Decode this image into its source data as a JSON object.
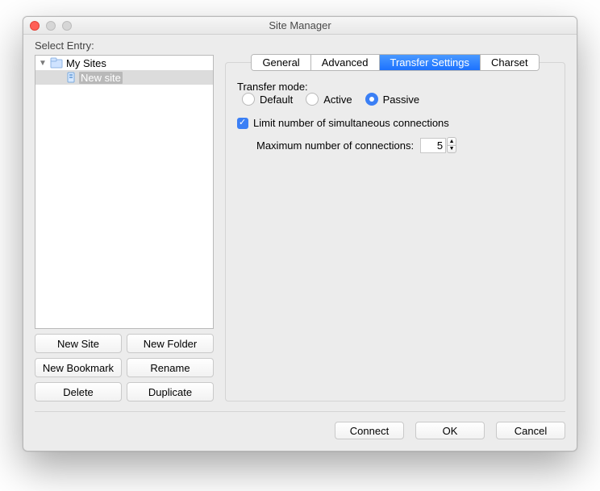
{
  "window": {
    "title": "Site Manager"
  },
  "left": {
    "header": "Select Entry:",
    "tree": {
      "root": {
        "label": "My Sites"
      },
      "child": {
        "label": "New site"
      }
    },
    "buttons": {
      "new_site": "New Site",
      "new_folder": "New Folder",
      "new_bookmark": "New Bookmark",
      "rename": "Rename",
      "delete": "Delete",
      "duplicate": "Duplicate"
    }
  },
  "tabs": {
    "general": "General",
    "advanced": "Advanced",
    "transfer": "Transfer Settings",
    "charset": "Charset"
  },
  "panel": {
    "mode_label": "Transfer mode:",
    "radios": {
      "default": "Default",
      "active": "Active",
      "passive": "Passive"
    },
    "selected_mode": "passive",
    "limit_label": "Limit number of simultaneous connections",
    "limit_checked": true,
    "max_label": "Maximum number of connections:",
    "max_value": "5"
  },
  "footer": {
    "connect": "Connect",
    "ok": "OK",
    "cancel": "Cancel"
  }
}
